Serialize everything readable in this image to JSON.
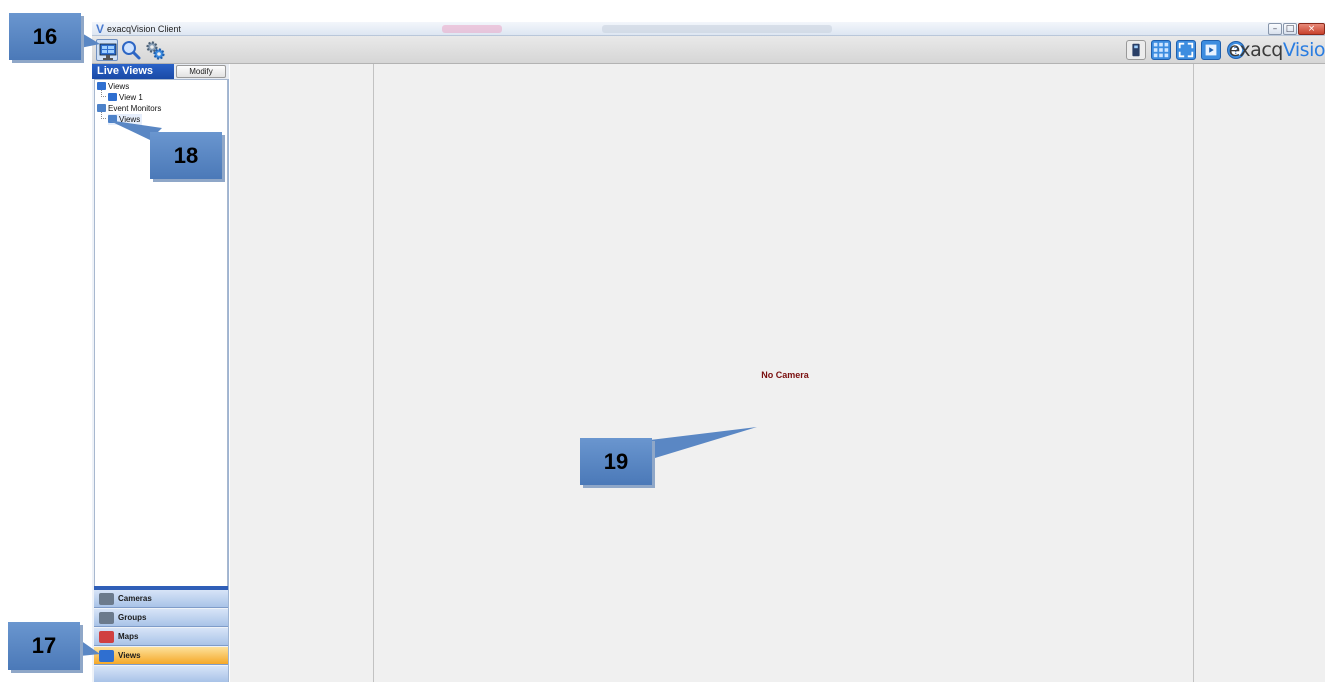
{
  "window": {
    "title": "exacqVision Client",
    "minimize_icon": "minimize-icon",
    "maximize_icon": "maximize-icon",
    "close_icon": "close-icon"
  },
  "toolbar": {
    "left_icons": [
      "live-view-icon",
      "search-icon",
      "setup-icon"
    ],
    "right_icons": [
      "device-icon",
      "grid-layout-icon",
      "fullscreen-icon",
      "playback-icon",
      "help-icon"
    ],
    "logo_prefix": "exacq",
    "logo_suffix": "Visio"
  },
  "left_panel": {
    "title": "Live Views",
    "modify_label": "Modify",
    "tree": [
      {
        "label": "Views",
        "icon": "views-icon"
      },
      {
        "label": "View 1",
        "icon": "view-icon"
      },
      {
        "label": "Event Monitors",
        "icon": "event-monitor-icon"
      },
      {
        "label": "Views",
        "icon": "event-monitor-icon"
      }
    ],
    "nav": [
      {
        "label": "Cameras",
        "icon": "camera-icon",
        "active": false
      },
      {
        "label": "Groups",
        "icon": "group-icon",
        "active": false
      },
      {
        "label": "Maps",
        "icon": "map-icon",
        "active": false
      },
      {
        "label": "Views",
        "icon": "views-icon",
        "active": true
      }
    ]
  },
  "viewer": {
    "status": "No Camera"
  },
  "callouts": [
    "16",
    "17",
    "18",
    "19"
  ],
  "colors": {
    "accent_blue": "#1a4aa6",
    "callout_blue": "#5a87c4",
    "active_nav": "#f5a828",
    "status_red": "#7a0f0f"
  }
}
